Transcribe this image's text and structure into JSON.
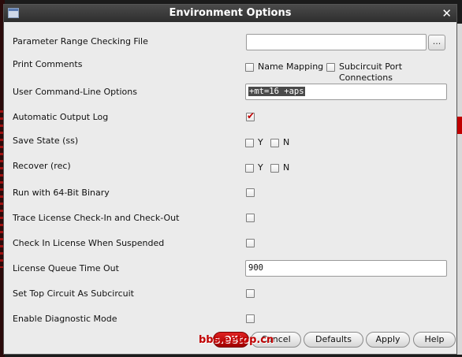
{
  "dialog": {
    "title": "Environment Options"
  },
  "rows": {
    "param_range": {
      "label": "Parameter Range Checking File",
      "value": "",
      "browse_label": "..."
    },
    "print_comments": {
      "label": "Print Comments",
      "opt1": "Name Mapping",
      "opt2": "Subcircuit Port Connections",
      "opt1_checked": false,
      "opt2_checked": false
    },
    "user_cmd": {
      "label": "User Command-Line Options",
      "value": "+mt=16 +aps"
    },
    "auto_log": {
      "label": "Automatic Output Log",
      "checked": true
    },
    "save_state": {
      "label": "Save State (ss)",
      "y": "Y",
      "n": "N"
    },
    "recover": {
      "label": "Recover (rec)",
      "y": "Y",
      "n": "N"
    },
    "run64": {
      "label": "Run with 64-Bit Binary"
    },
    "trace_license": {
      "label": "Trace License Check-In and Check-Out"
    },
    "checkin_license": {
      "label": "Check In License When Suspended"
    },
    "license_queue": {
      "label": "License Queue Time Out",
      "value": "900"
    },
    "set_top": {
      "label": "Set Top Circuit As Subcircuit"
    },
    "diag": {
      "label": "Enable Diagnostic Mode"
    }
  },
  "buttons": {
    "ok": "OK",
    "cancel": "Cancel",
    "defaults": "Defaults",
    "apply": "Apply",
    "help": "Help"
  },
  "watermark": "bbs.eetop.cn"
}
